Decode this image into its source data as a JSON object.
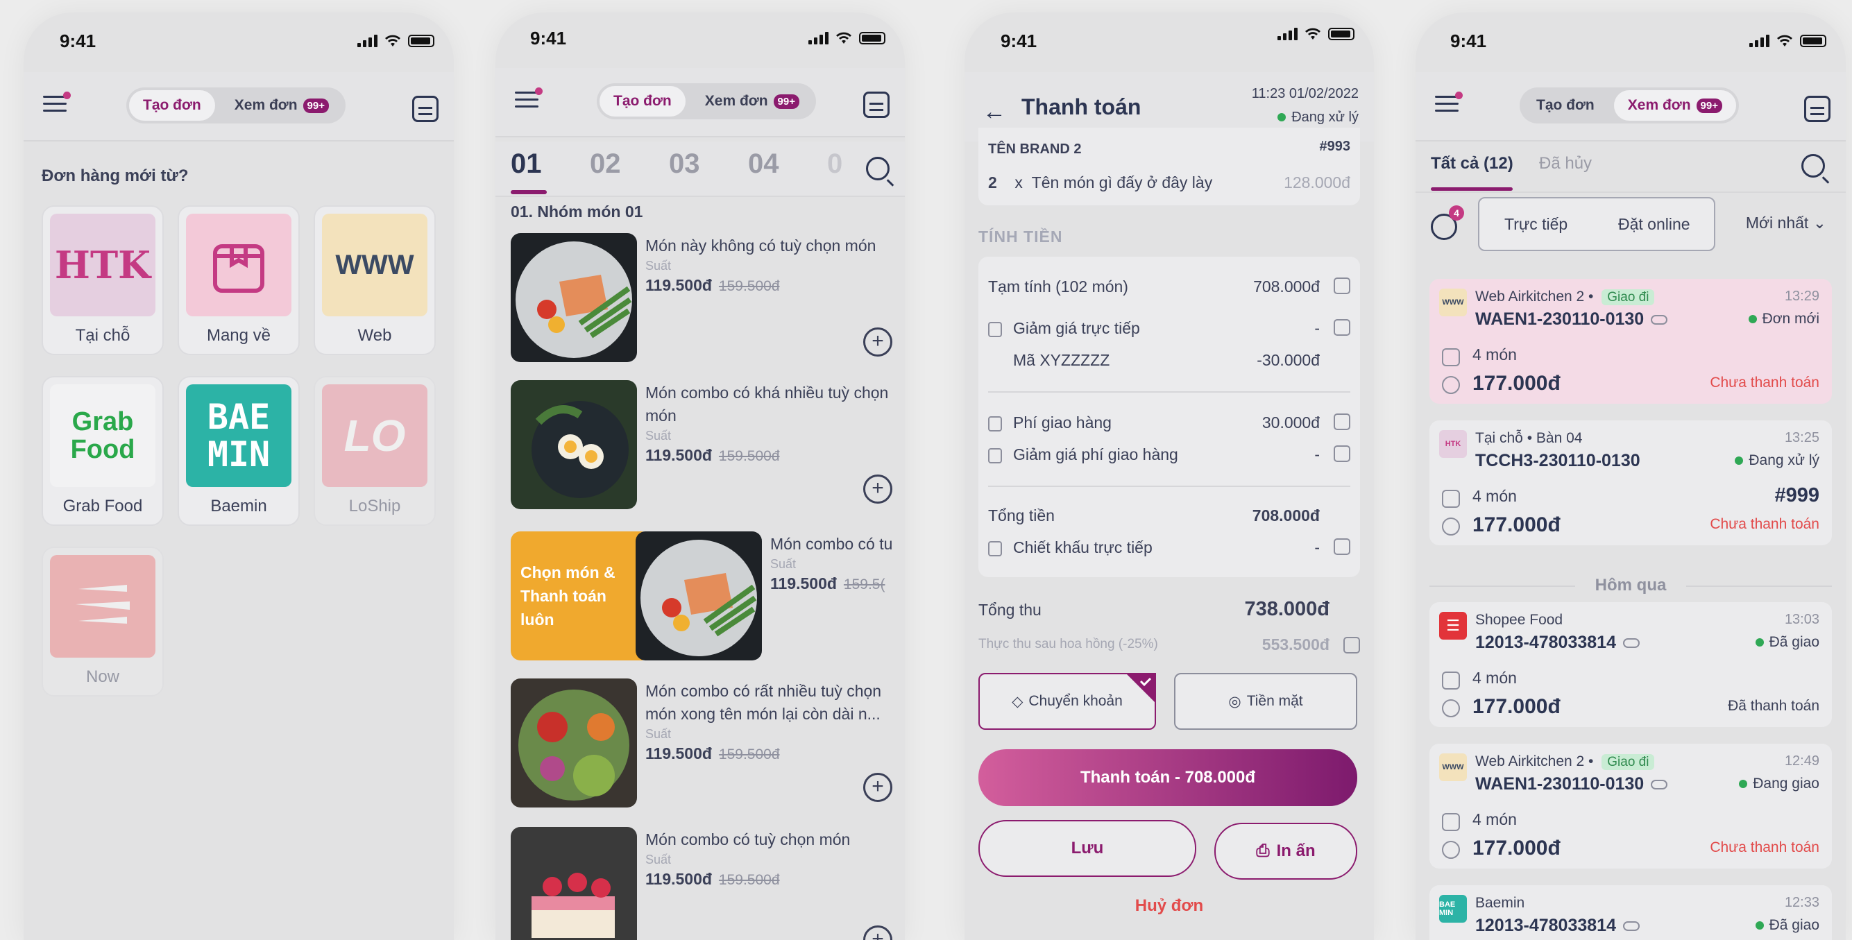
{
  "status_time": "9:41",
  "nav": {
    "create_label": "Tạo đơn",
    "view_label": "Xem đơn",
    "badge": "99+"
  },
  "screen1": {
    "heading": "Đơn hàng mới từ?",
    "tiles": [
      {
        "label": "Tại chỗ",
        "logo": "HTK"
      },
      {
        "label": "Mang về",
        "logo": ""
      },
      {
        "label": "Web",
        "logo": "WWW"
      },
      {
        "label": "Grab Food",
        "logo": "Grab Food"
      },
      {
        "label": "Baemin",
        "logo": "BAE MIN"
      },
      {
        "label": "LoShip",
        "logo": "LO"
      },
      {
        "label": "Now",
        "logo": ""
      }
    ]
  },
  "screen2": {
    "tabs": [
      "01",
      "02",
      "03",
      "04",
      "0"
    ],
    "group_title": "01. Nhóm món 01",
    "cta": "Chọn món & Thanh toán luôn",
    "items": [
      {
        "name": "Món này không có tuỳ chọn món",
        "unit": "Suất",
        "price": "119.500đ",
        "old_price": "159.500đ"
      },
      {
        "name": "Món combo có khá nhiều tuỳ chọn món",
        "unit": "Suất",
        "price": "119.500đ",
        "old_price": "159.500đ"
      },
      {
        "name": "Món combo có tu",
        "unit": "Suất",
        "price": "119.500đ",
        "old_price": "159.5("
      },
      {
        "name": "Món combo có rất nhiều tuỳ chọn món xong tên món lại còn dài n...",
        "unit": "Suất",
        "price": "119.500đ",
        "old_price": "159.500đ"
      },
      {
        "name": "Món combo có tuỳ chọn món",
        "unit": "Suất",
        "price": "119.500đ",
        "old_price": "159.500đ"
      }
    ]
  },
  "screen3": {
    "title": "Thanh toán",
    "datetime": "11:23 01/02/2022",
    "status": "Đang xử lý",
    "brand": "TÊN BRAND 2",
    "order_no": "#993",
    "line_qty": "2",
    "line_x": "x",
    "line_name": "Tên món gì đấy ở đây lày",
    "line_price": "128.000đ",
    "section": "TÍNH TIỀN",
    "subtotal_label": "Tạm tính (102 món)",
    "subtotal": "708.000đ",
    "direct_discount_label": "Giảm giá trực tiếp",
    "direct_discount": "-",
    "code_label": "Mã XYZZZZZ",
    "code_value": "-30.000đ",
    "ship_label": "Phí giao hàng",
    "ship": "30.000đ",
    "ship_discount_label": "Giảm giá phí giao hàng",
    "ship_discount": "-",
    "total_label": "Tổng tiền",
    "total": "708.000đ",
    "commission_label": "Chiết khấu trực tiếp",
    "commission": "-",
    "revenue_label": "Tổng thu",
    "revenue": "738.000đ",
    "net_label": "Thực thu sau hoa hồng (-25%)",
    "net": "553.500đ",
    "method_transfer": "Chuyển khoản",
    "method_cash": "Tiền mặt",
    "pay_button": "Thanh toán - 708.000đ",
    "save_button": "Lưu",
    "print_button": "In ấn",
    "cancel": "Huỷ đơn"
  },
  "screen4": {
    "tab_all": "Tất cả (12)",
    "tab_cancel": "Đã hủy",
    "filter_badge": "4",
    "filter_direct": "Trực tiếp",
    "filter_online": "Đặt online",
    "sort": "Mới nhất",
    "yesterday": "Hôm qua",
    "orders": [
      {
        "source": "Web Airkitchen 2",
        "dot": "•",
        "tag": "Giao đi",
        "code": "WAEN1-230110-0130",
        "time": "13:29",
        "status": "Đơn mới",
        "qty": "4 món",
        "amount": "177.000đ",
        "pay": "Chưa thanh toán",
        "extra": ""
      },
      {
        "source": "Tại chỗ",
        "dot": "•",
        "tag": "Bàn 04",
        "code": "TCCH3-230110-0130",
        "time": "13:25",
        "status": "Đang xử lý",
        "qty": "4 món",
        "amount": "177.000đ",
        "pay": "Chưa thanh toán",
        "extra": "#999"
      },
      {
        "source": "Shopee Food",
        "dot": "",
        "tag": "",
        "code": "12013-478033814",
        "time": "13:03",
        "status": "Đã giao",
        "qty": "4 món",
        "amount": "177.000đ",
        "pay": "Đã thanh toán",
        "extra": ""
      },
      {
        "source": "Web Airkitchen 2",
        "dot": "•",
        "tag": "Giao đi",
        "code": "WAEN1-230110-0130",
        "time": "12:49",
        "status": "Đang giao",
        "qty": "4 món",
        "amount": "177.000đ",
        "pay": "Chưa thanh toán",
        "extra": ""
      },
      {
        "source": "Baemin",
        "dot": "",
        "tag": "",
        "code": "12013-478033814",
        "time": "12:33",
        "status": "Đã giao",
        "qty": "",
        "amount": "",
        "pay": "",
        "extra": ""
      }
    ]
  }
}
